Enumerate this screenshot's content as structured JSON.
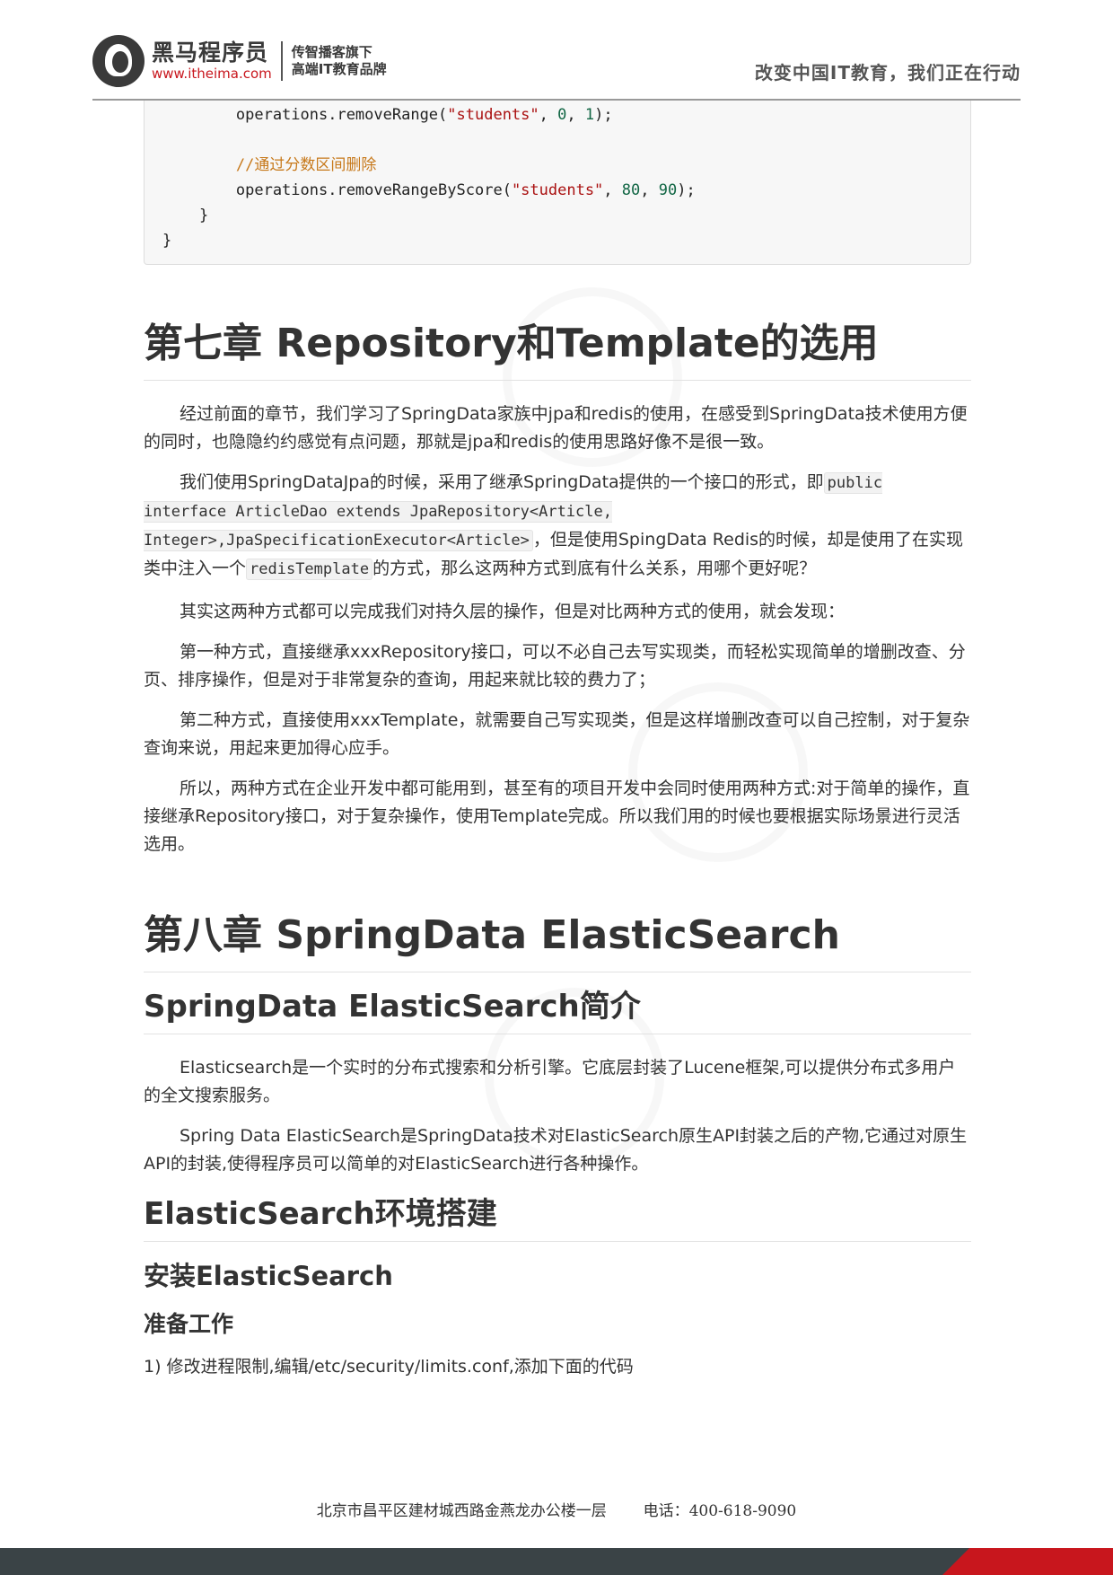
{
  "header": {
    "brand_name": "黑马程序员",
    "brand_url": "www.itheima.com",
    "tagline_line1": "传智播客旗下",
    "tagline_line2": "高端IT教育品牌",
    "slogan": "改变中国IT教育，我们正在行动"
  },
  "code": {
    "line1_pre": "        operations.removeRange(",
    "line1_str": "\"students\"",
    "line1_mid": ", ",
    "line1_num1": "0",
    "line1_sep": ", ",
    "line1_num2": "1",
    "line1_end": ");",
    "comment": "        //通过分数区间删除",
    "line3_pre": "        operations.removeRangeByScore(",
    "line3_str": "\"students\"",
    "line3_mid": ", ",
    "line3_num1": "80",
    "line3_sep": ", ",
    "line3_num2": "90",
    "line3_end": ");",
    "close_inner": "    }",
    "close_outer": "}"
  },
  "chapter7": {
    "title": "第七章 Repository和Template的选用",
    "p1": "经过前面的章节，我们学习了SpringData家族中jpa和redis的使用，在感受到SpringData技术使用方便的同时，也隐隐约约感觉有点问题，那就是jpa和redis的使用思路好像不是很一致。",
    "p2_before": "我们使用SpringDataJpa的时候，采用了继承SpringData提供的一个接口的形式，即",
    "p2_code1": "public interface ArticleDao extends JpaRepository<Article, Integer>,JpaSpecificationExecutor<Article>",
    "p2_middle": "，但是使用SpingData Redis的时候，却是使用了在实现类中注入一个",
    "p2_code2": "redisTemplate",
    "p2_after": "的方式，那么这两种方式到底有什么关系，用哪个更好呢？",
    "p3": "其实这两种方式都可以完成我们对持久层的操作，但是对比两种方式的使用，就会发现：",
    "p4": "第一种方式，直接继承xxxRepository接口，可以不必自己去写实现类，而轻松实现简单的增删改查、分页、排序操作，但是对于非常复杂的查询，用起来就比较的费力了；",
    "p5": "第二种方式，直接使用xxxTemplate，就需要自己写实现类，但是这样增删改查可以自己控制，对于复杂查询来说，用起来更加得心应手。",
    "p6": "所以，两种方式在企业开发中都可能用到，甚至有的项目开发中会同时使用两种方式:对于简单的操作，直接继承Repository接口，对于复杂操作，使用Template完成。所以我们用的时候也要根据实际场景进行灵活选用。"
  },
  "chapter8": {
    "title": "第八章 SpringData ElasticSearch",
    "intro_title": "SpringData ElasticSearch简介",
    "intro_p1": "Elasticsearch是一个实时的分布式搜索和分析引擎。它底层封装了Lucene框架,可以提供分布式多用户的全文搜索服务。",
    "intro_p2": "Spring Data ElasticSearch是SpringData技术对ElasticSearch原生API封装之后的产物,它通过对原生API的封装,使得程序员可以简单的对ElasticSearch进行各种操作。",
    "env_title": "ElasticSearch环境搭建",
    "install_title": "安装ElasticSearch",
    "prep_title": "准备工作",
    "step1": "1) 修改进程限制,编辑/etc/security/limits.conf,添加下面的代码"
  },
  "footer": {
    "address": "北京市昌平区建材城西路金燕龙办公楼一层",
    "phone": "电话：400-618-9090"
  }
}
